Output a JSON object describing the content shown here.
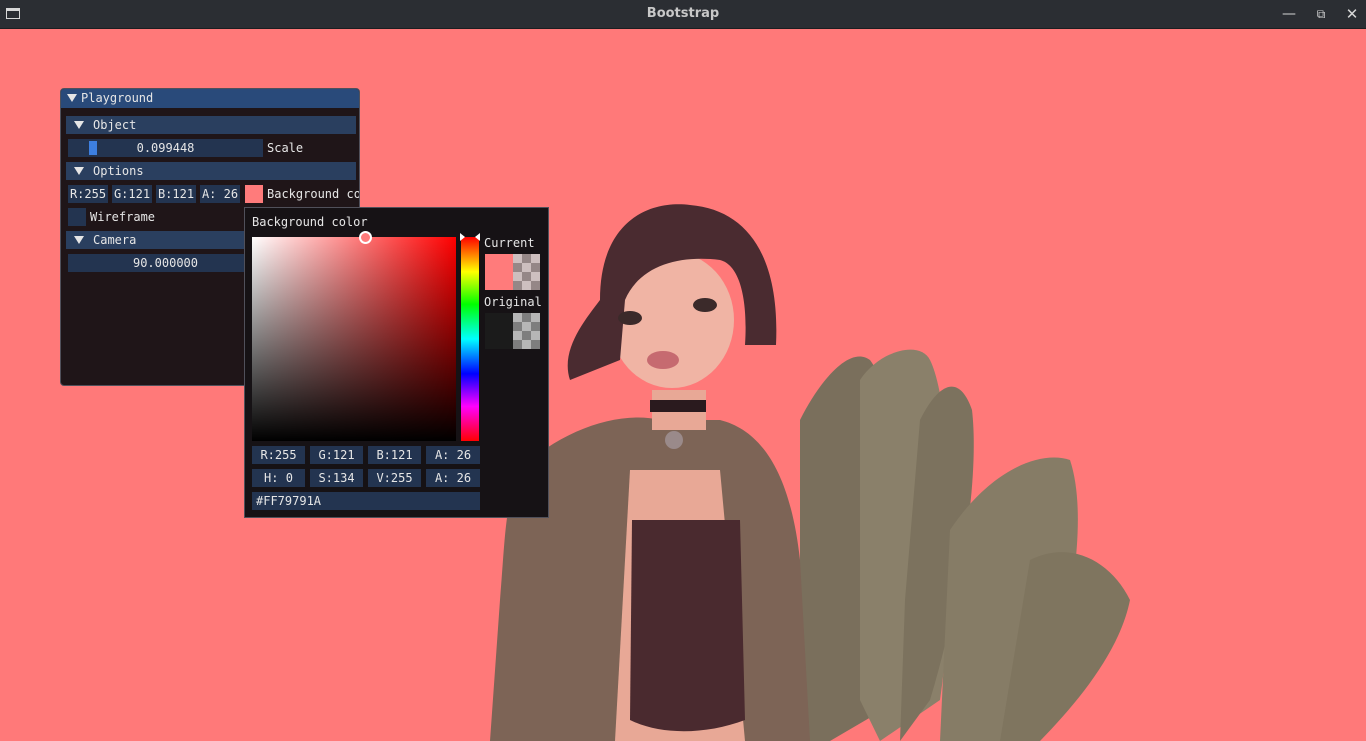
{
  "window": {
    "title": "Bootstrap"
  },
  "colors": {
    "scene_background": "#ff7979",
    "header": "#294a7a",
    "section": "#2a3f5f",
    "field": "#233450",
    "current_color": "#FF79791A",
    "original_color": "#1b1b1b"
  },
  "icons": [
    "app-window-icon",
    "minimize-icon",
    "restore-icon",
    "close-icon",
    "collapse-arrow-icon"
  ],
  "playground": {
    "title": "Playground",
    "object": {
      "header": "Object",
      "scale_value": "0.099448",
      "scale_label": "Scale",
      "scale_fraction": 0.03
    },
    "options": {
      "header": "Options",
      "r": "R:255",
      "g": "G:121",
      "b": "B:121",
      "a": "A: 26",
      "color_label": "Background co",
      "wireframe_label": "Wireframe",
      "wireframe_checked": false
    },
    "camera": {
      "header": "Camera",
      "value": "90.000000"
    }
  },
  "picker": {
    "title": "Background color",
    "current_label": "Current",
    "original_label": "Original",
    "rgba": [
      "R:255",
      "G:121",
      "B:121",
      "A: 26"
    ],
    "hsva": [
      "H:  0",
      "S:134",
      "V:255",
      "A: 26"
    ],
    "hex": "#FF79791A"
  }
}
